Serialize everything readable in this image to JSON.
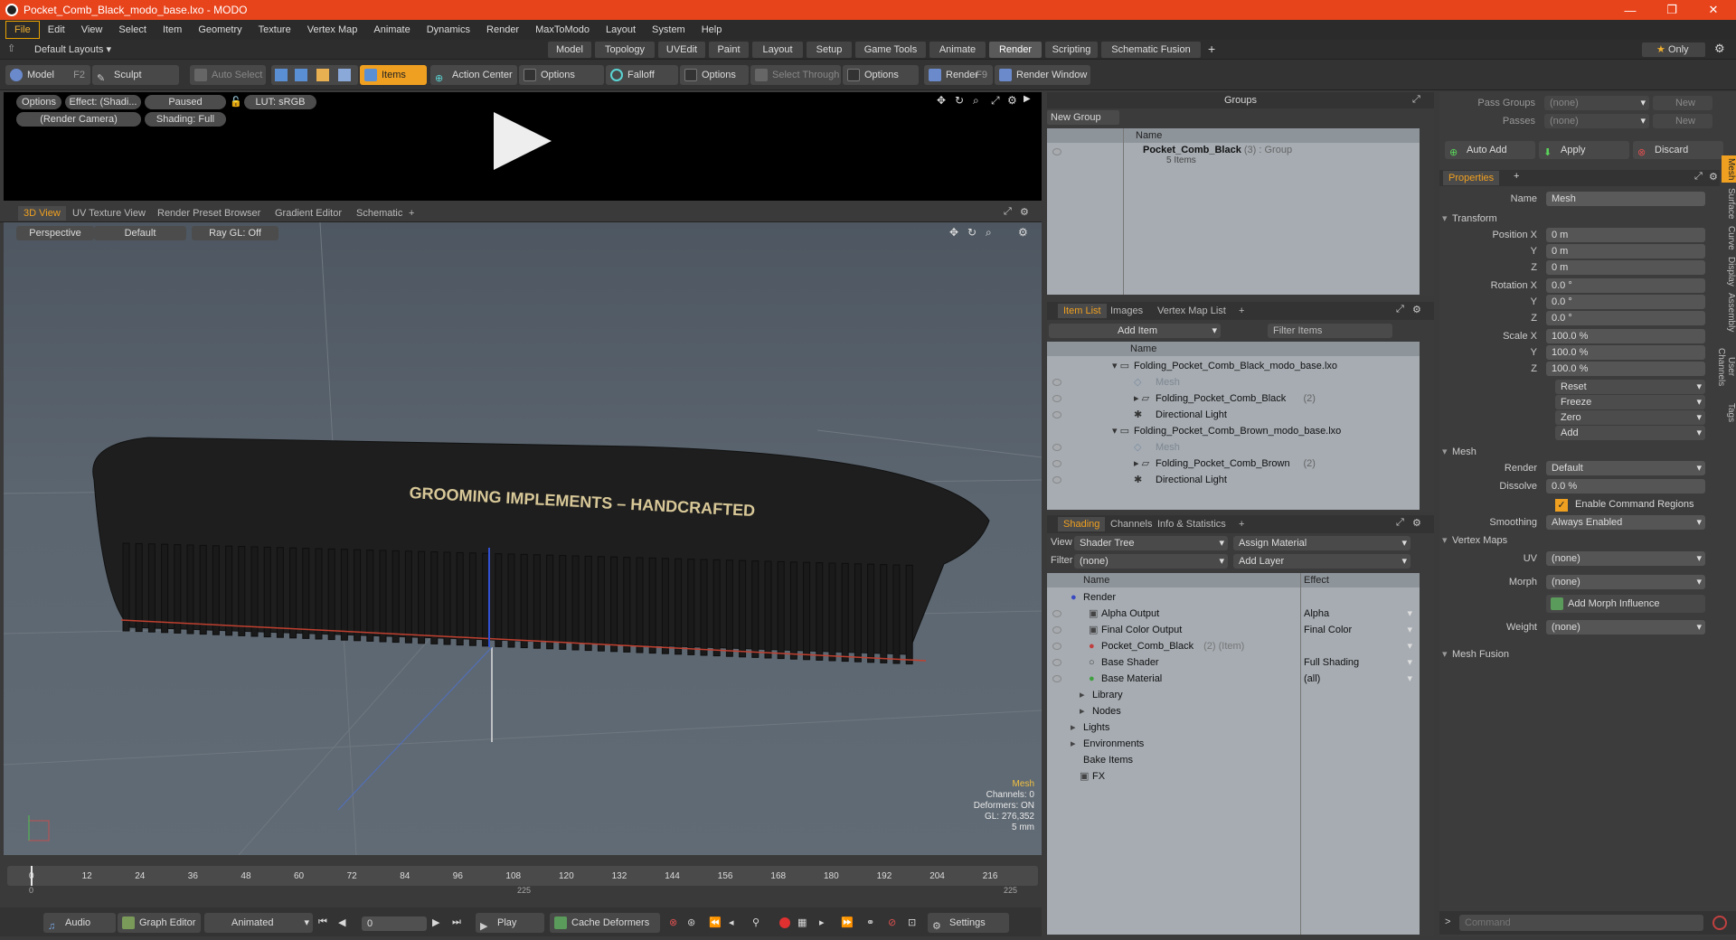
{
  "window": {
    "title": "Pocket_Comb_Black_modo_base.lxo - MODO"
  },
  "menu": [
    "File",
    "Edit",
    "View",
    "Select",
    "Item",
    "Geometry",
    "Texture",
    "Vertex Map",
    "Animate",
    "Dynamics",
    "Render",
    "MaxToModo",
    "Layout",
    "System",
    "Help"
  ],
  "layout": {
    "preset": "Default Layouts",
    "tabs": [
      "Model",
      "Topology",
      "UVEdit",
      "Paint",
      "Layout",
      "Setup",
      "Game Tools",
      "Animate",
      "Render",
      "Scripting",
      "Schematic Fusion"
    ],
    "active_tab": "Render",
    "only_label": "Only"
  },
  "toolbar": {
    "model": "Model",
    "model_key": "F2",
    "sculpt": "Sculpt",
    "auto_select": "Auto Select",
    "items": "Items",
    "action_center": "Action Center",
    "options1": "Options",
    "falloff": "Falloff",
    "options2": "Options",
    "select_through": "Select Through",
    "options3": "Options",
    "render": "Render",
    "render_key": "F9",
    "render_window": "Render Window"
  },
  "preview": {
    "options": "Options",
    "effect": "Effect: (Shadi...",
    "paused": "Paused",
    "lut": "LUT: sRGB",
    "camera": "(Render Camera)",
    "shading": "Shading: Full"
  },
  "viewport": {
    "tabs": [
      "3D View",
      "UV Texture View",
      "Render Preset Browser",
      "Gradient Editor",
      "Schematic"
    ],
    "active_tab": "3D View",
    "perspective": "Perspective",
    "default": "Default",
    "raygl": "Ray GL: Off",
    "comb_text": "GROOMING IMPLEMENTS – HANDCRAFTED",
    "info": {
      "mesh": "Mesh",
      "channels": "Channels: 0",
      "deformers": "Deformers: ON",
      "gl": "GL: 276,352",
      "scale": "5 mm"
    }
  },
  "timeline": {
    "ticks": [
      "0",
      "12",
      "24",
      "36",
      "48",
      "60",
      "72",
      "84",
      "96",
      "108",
      "120",
      "132",
      "144",
      "156",
      "168",
      "180",
      "192",
      "204",
      "216"
    ],
    "sub_ticks": [
      "0",
      "225",
      "225"
    ]
  },
  "transport": {
    "audio": "Audio",
    "graph_editor": "Graph Editor",
    "animated": "Animated",
    "frame": "0",
    "play": "Play",
    "cache_deformers": "Cache Deformers",
    "settings": "Settings"
  },
  "groups": {
    "title": "Groups",
    "new_group": "New Group",
    "name_header": "Name",
    "item_name": "Pocket_Comb_Black",
    "item_suffix": "(3) : Group",
    "item_count": "5 Items"
  },
  "itemlist": {
    "tabs": [
      "Item List",
      "Images",
      "Vertex Map List"
    ],
    "add_item": "Add Item",
    "filter_items": "Filter Items",
    "name_header": "Name",
    "rows": [
      {
        "label": "Folding_Pocket_Comb_Black_modo_base.lxo",
        "suffix": "",
        "dim": false
      },
      {
        "label": "Mesh",
        "suffix": "",
        "dim": true
      },
      {
        "label": "Folding_Pocket_Comb_Black",
        "suffix": "(2)",
        "dim": false
      },
      {
        "label": "Directional Light",
        "suffix": "",
        "dim": false
      },
      {
        "label": "Folding_Pocket_Comb_Brown_modo_base.lxo",
        "suffix": "",
        "dim": false
      },
      {
        "label": "Mesh",
        "suffix": "",
        "dim": true
      },
      {
        "label": "Folding_Pocket_Comb_Brown",
        "suffix": "(2)",
        "dim": false
      },
      {
        "label": "Directional Light",
        "suffix": "",
        "dim": false
      }
    ]
  },
  "shading": {
    "tabs": [
      "Shading",
      "Channels",
      "Info & Statistics"
    ],
    "view_label": "View",
    "view_value": "Shader Tree",
    "assign_material": "Assign Material",
    "filter_label": "Filter",
    "filter_value": "(none)",
    "add_layer": "Add Layer",
    "name_header": "Name",
    "effect_header": "Effect",
    "rows": [
      {
        "name": "Render",
        "effect": ""
      },
      {
        "name": "Alpha Output",
        "effect": "Alpha"
      },
      {
        "name": "Final Color Output",
        "effect": "Final Color"
      },
      {
        "name": "Pocket_Comb_Black",
        "suffix": "(2) (Item)",
        "effect": ""
      },
      {
        "name": "Base Shader",
        "effect": "Full Shading"
      },
      {
        "name": "Base Material",
        "effect": "(all)"
      },
      {
        "name": "Library",
        "effect": ""
      },
      {
        "name": "Nodes",
        "effect": ""
      },
      {
        "name": "Lights",
        "effect": ""
      },
      {
        "name": "Environments",
        "effect": ""
      },
      {
        "name": "Bake Items",
        "effect": ""
      },
      {
        "name": "FX",
        "effect": ""
      }
    ]
  },
  "passes": {
    "pass_groups": "Pass Groups",
    "passes": "Passes",
    "none": "(none)",
    "new": "New",
    "auto_add": "Auto Add",
    "apply": "Apply",
    "discard": "Discard"
  },
  "properties": {
    "tab": "Properties",
    "name_label": "Name",
    "name_value": "Mesh",
    "transform": "Transform",
    "position": [
      "0 m",
      "0 m",
      "0 m"
    ],
    "rotation": [
      "0.0 °",
      "0.0 °",
      "0.0 °"
    ],
    "scale": [
      "100.0 %",
      "100.0 %",
      "100.0 %"
    ],
    "position_label": "Position X",
    "rotation_label": "Rotation X",
    "scale_label": "Scale X",
    "y": "Y",
    "z": "Z",
    "actions": [
      "Reset",
      "Freeze",
      "Zero",
      "Add"
    ],
    "mesh_section": "Mesh",
    "render_label": "Render",
    "render_value": "Default",
    "dissolve_label": "Dissolve",
    "dissolve_value": "0.0 %",
    "command_regions": "Enable Command Regions",
    "smoothing_label": "Smoothing",
    "smoothing_value": "Always Enabled",
    "vertex_maps": "Vertex Maps",
    "uv_label": "UV",
    "uv_value": "(none)",
    "morph_label": "Morph",
    "morph_value": "(none)",
    "add_morph": "Add Morph Influence",
    "weight_label": "Weight",
    "weight_value": "(none)",
    "mesh_fusion": "Mesh Fusion",
    "side_tabs": [
      "Mesh",
      "Surface",
      "Curve",
      "Display",
      "Assembly",
      "User Channels",
      "Tags"
    ],
    "command_placeholder": "Command"
  }
}
